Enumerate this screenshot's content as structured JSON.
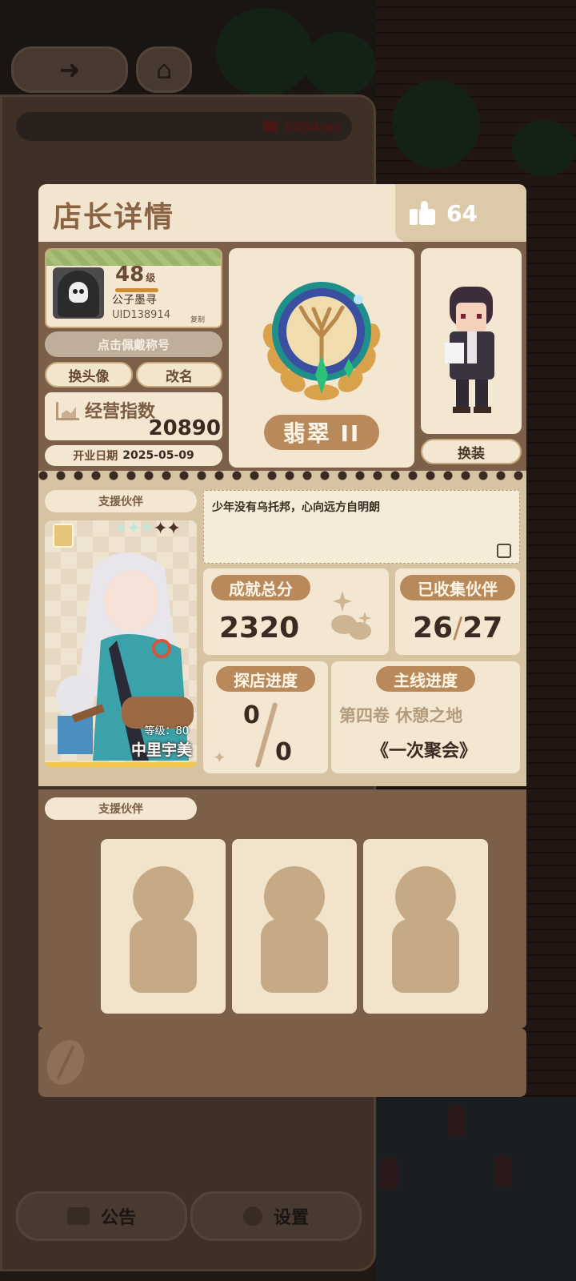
{
  "background": {
    "ping": "5054ms",
    "notice_button": "公告",
    "settings_button": "设置",
    "behind_name": "公子墨寻"
  },
  "dialog": {
    "title": "店长详情",
    "likes": "64"
  },
  "profile": {
    "level": "48",
    "level_unit": "级",
    "name": "公子墨寻",
    "uid": "UID138914",
    "copy_label": "复制",
    "wear_title_button": "点击佩戴称号",
    "change_avatar_button": "换头像",
    "rename_button": "改名",
    "business_index_label": "经营指数",
    "business_index_value": "20890",
    "open_date_label": "开业日期",
    "open_date_value": "2025-05-09"
  },
  "rank": {
    "name": "翡翠 II"
  },
  "outfit": {
    "change_button": "换装"
  },
  "partner_section": {
    "tag": "支援伙伴",
    "partner_level": "等级：80",
    "partner_name": "中里宇美",
    "stars_filled": 3,
    "stars_empty": 2
  },
  "motto": "少年没有乌托邦，心向远方自明朗",
  "stats": {
    "achievement_label": "成就总分",
    "achievement_value": "2320",
    "collected_label": "已收集伙伴",
    "collected_current": "26",
    "collected_total": "27",
    "explore_label": "探店进度",
    "explore_current": "0",
    "explore_total": "0",
    "story_label": "主线进度",
    "story_chapter": "第四卷 休憩之地",
    "story_episode": "《一次聚会》"
  },
  "support_section": {
    "tag": "支援伙伴"
  },
  "colors": {
    "panel_brown": "#7b5f48",
    "cream": "#f3e7d2",
    "accent_tan": "#b8895a",
    "header_text": "#8a6442"
  }
}
